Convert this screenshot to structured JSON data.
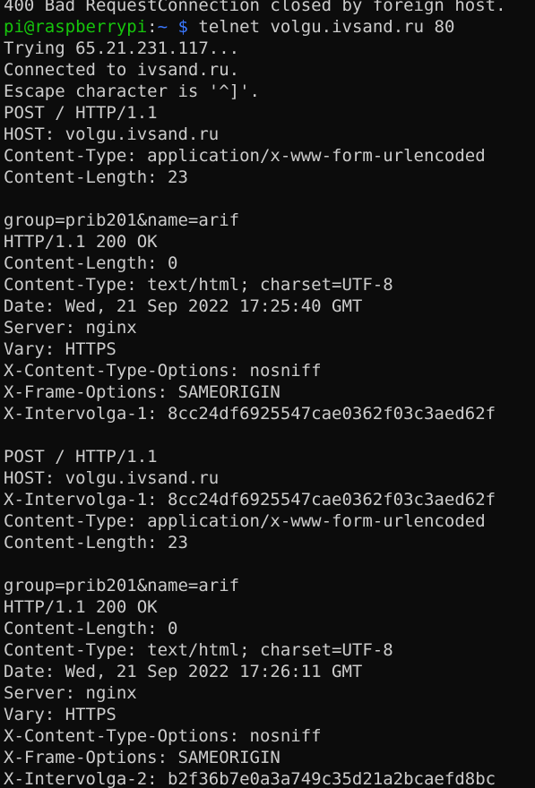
{
  "colors": {
    "background": "#0c0c0c",
    "foreground": "#cccccc",
    "prompt_user_host": "#16c60c",
    "prompt_path": "#3b78ff"
  },
  "terminal": {
    "top_partial_line": "400 Bad RequestConnection closed by foreign host.",
    "prompt": {
      "user_host": "pi@raspberrypi",
      "separator": ":",
      "path": "~",
      "dollar": "$",
      "command": " telnet volgu.ivsand.ru 80"
    },
    "lines": [
      "Trying 65.21.231.117...",
      "Connected to ivsand.ru.",
      "Escape character is '^]'.",
      "POST / HTTP/1.1",
      "HOST: volgu.ivsand.ru",
      "Content-Type: application/x-www-form-urlencoded",
      "Content-Length: 23",
      "",
      "group=prib201&name=arif",
      "HTTP/1.1 200 OK",
      "Content-Length: 0",
      "Content-Type: text/html; charset=UTF-8",
      "Date: Wed, 21 Sep 2022 17:25:40 GMT",
      "Server: nginx",
      "Vary: HTTPS",
      "X-Content-Type-Options: nosniff",
      "X-Frame-Options: SAMEORIGIN",
      "X-Intervolga-1: 8cc24df6925547cae0362f03c3aed62f",
      "",
      "POST / HTTP/1.1",
      "HOST: volgu.ivsand.ru",
      "X-Intervolga-1: 8cc24df6925547cae0362f03c3aed62f",
      "Content-Type: application/x-www-form-urlencoded",
      "Content-Length: 23",
      "",
      "group=prib201&name=arif",
      "HTTP/1.1 200 OK",
      "Content-Length: 0",
      "Content-Type: text/html; charset=UTF-8",
      "Date: Wed, 21 Sep 2022 17:26:11 GMT",
      "Server: nginx",
      "Vary: HTTPS",
      "X-Content-Type-Options: nosniff",
      "X-Frame-Options: SAMEORIGIN",
      "X-Intervolga-2: b2f36b7e0a3a749c35d21a2bcaefd8bc"
    ]
  }
}
